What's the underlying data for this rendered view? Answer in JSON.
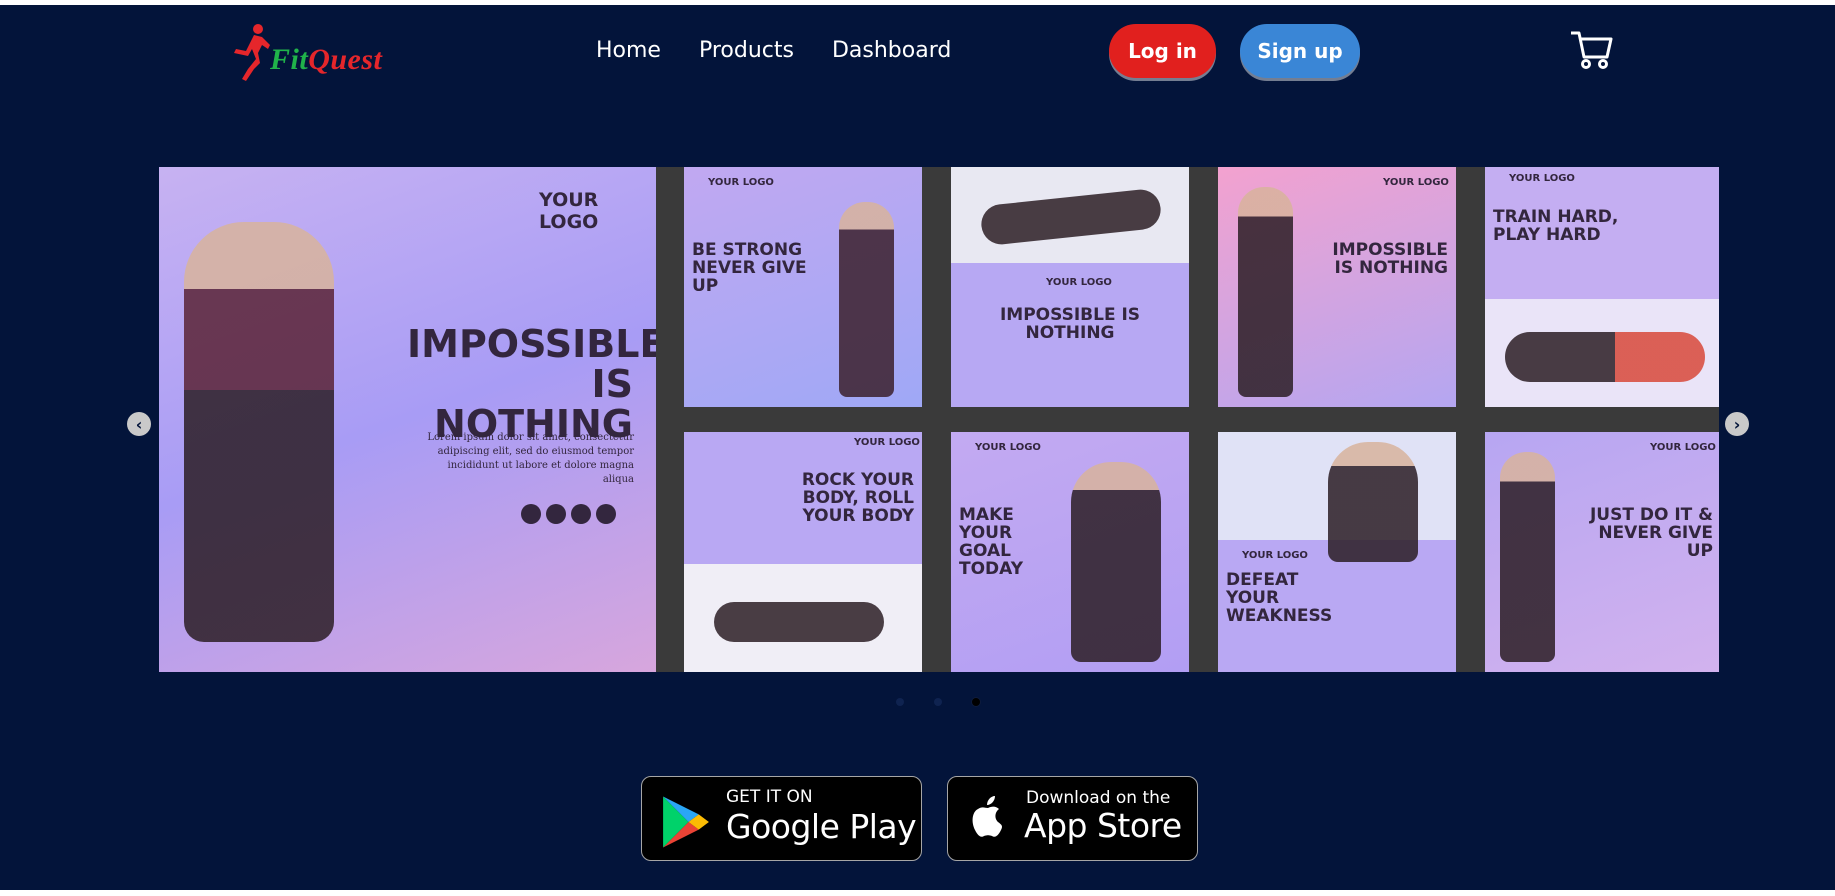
{
  "brand": {
    "name_part1": "Fit",
    "name_part2": "Quest"
  },
  "nav": {
    "items": [
      "Home",
      "Products",
      "Dashboard"
    ]
  },
  "auth": {
    "login_label": "Log in",
    "signup_label": "Sign up"
  },
  "colors": {
    "background": "#03143a",
    "login": "#e1201e",
    "signup": "#3a86d6",
    "poster_bg": "#b9a6f0"
  },
  "carousel": {
    "tiles": [
      {
        "headline": "IMPOSSIBLE IS NOTHING",
        "logo": "YOUR LOGO",
        "body": "Lorem ipsum dolor sit amet, consectetur adipiscing elit, sed do eiusmod tempor incididunt ut labore et dolore magna aliqua"
      },
      {
        "headline": "BE STRONG NEVER GIVE UP",
        "logo": "YOUR LOGO"
      },
      {
        "headline": "IMPOSSIBLE IS NOTHING",
        "logo": "YOUR LOGO"
      },
      {
        "headline": "IMPOSSIBLE IS NOTHING",
        "logo": "YOUR LOGO"
      },
      {
        "headline": "TRAIN HARD, PLAY HARD",
        "logo": "YOUR LOGO"
      },
      {
        "headline": "ROCK YOUR BODY, ROLL YOUR BODY",
        "logo": "YOUR LOGO"
      },
      {
        "headline": "MAKE YOUR GOAL TODAY",
        "logo": "YOUR LOGO"
      },
      {
        "headline": "DEFEAT YOUR WEAKNESS",
        "logo": "YOUR LOGO"
      },
      {
        "headline": "JUST DO IT & NEVER GIVE UP",
        "logo": "YOUR LOGO"
      }
    ],
    "prev_icon": "chevron-left-icon",
    "next_icon": "chevron-right-icon",
    "page_count": 3,
    "active_page": 3
  },
  "stores": {
    "google": {
      "small": "GET IT ON",
      "big": "Google Play"
    },
    "apple": {
      "small": "Download on the",
      "big": "App Store"
    }
  }
}
